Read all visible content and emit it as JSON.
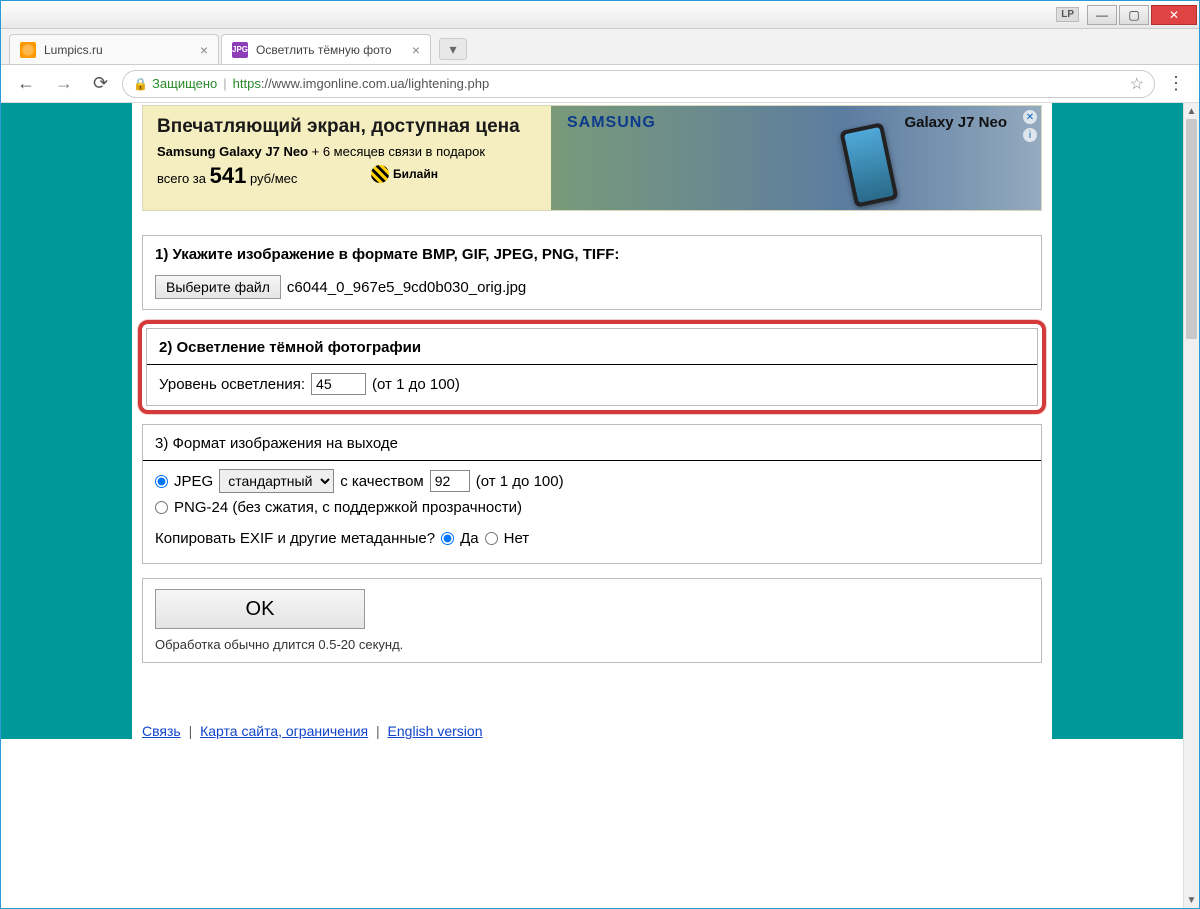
{
  "titlebar": {
    "badge": "LP"
  },
  "tabs": {
    "t1": "Lumpics.ru",
    "t2": "Осветлить тёмную фото",
    "fav2": "JPG"
  },
  "urlbar": {
    "secure": "Защищено",
    "https": "https",
    "rest": "://www.imgonline.com.ua/lightening.php"
  },
  "ad": {
    "headline": "Впечатляющий экран, доступная цена",
    "sub": "Samsung Galaxy J7 Neo + 6 месяцев связи в подарок",
    "price_pre": "всего за ",
    "price_val": "541",
    "price_suf": " руб/мес",
    "beeline": "Билайн",
    "samsung": "SAMSUNG",
    "galaxy": "Galaxy J7 Neo"
  },
  "s1": {
    "title": "1) Укажите изображение в формате BMP, GIF, JPEG, PNG, TIFF:",
    "btn": "Выберите файл",
    "file": "c6044_0_967e5_9cd0b030_orig.jpg"
  },
  "s2": {
    "title": "2) Осветление тёмной фотографии",
    "label": "Уровень осветления:",
    "value": "45",
    "hint": "(от 1 до 100)"
  },
  "s3": {
    "title": "3) Формат изображения на выходе",
    "jpeg": "JPEG",
    "jpeg_sel": "стандартный",
    "jpeg_q_label": "с качеством",
    "jpeg_q": "92",
    "jpeg_hint": "(от 1 до 100)",
    "png": "PNG-24 (без сжатия, с поддержкой прозрачности)",
    "exif_q": "Копировать EXIF и другие метаданные?",
    "yes": "Да",
    "no": "Нет"
  },
  "submit": {
    "ok": "OK",
    "note": "Обработка обычно длится 0.5-20 секунд."
  },
  "footer": {
    "l1": "Связь",
    "l2": "Карта сайта, ограничения",
    "l3": "English version"
  }
}
